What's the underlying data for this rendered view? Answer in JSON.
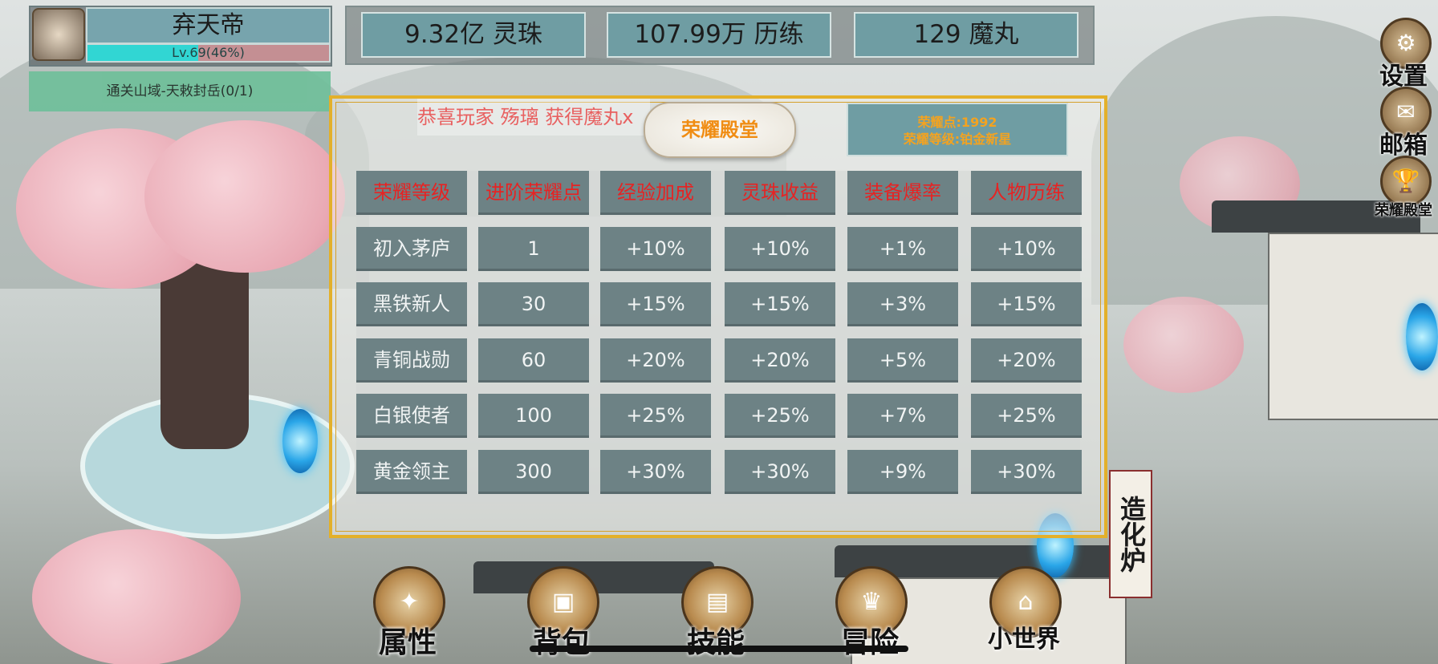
{
  "player": {
    "name": "弃天帝",
    "level_text": "Lv.69(46%)",
    "level_progress": 0.46
  },
  "quest": {
    "text": "通关山域-天敕封岳(0/1)"
  },
  "resources": [
    {
      "label": "9.32亿 灵珠"
    },
    {
      "label": "107.99万 历练"
    },
    {
      "label": "129 魔丸"
    }
  ],
  "side_buttons": {
    "settings": {
      "label": "设置",
      "icon": "gear-icon"
    },
    "mail": {
      "label": "邮箱",
      "icon": "envelope-icon"
    },
    "honor_hall": {
      "label": "荣耀殿堂",
      "icon": "trophy-icon"
    }
  },
  "panel": {
    "ticker": "恭喜玩家 殇璃 获得魔丸x",
    "title": "荣耀殿堂",
    "honor_points": "荣耀点:1992",
    "honor_level": "荣耀等级:铂金新星"
  },
  "table": {
    "headers": [
      "荣耀等级",
      "进阶荣耀点",
      "经验加成",
      "灵珠收益",
      "装备爆率",
      "人物历练"
    ],
    "rows": [
      [
        "初入茅庐",
        "1",
        "+10%",
        "+10%",
        "+1%",
        "+10%"
      ],
      [
        "黑铁新人",
        "30",
        "+15%",
        "+15%",
        "+3%",
        "+15%"
      ],
      [
        "青铜战勋",
        "60",
        "+20%",
        "+20%",
        "+5%",
        "+20%"
      ],
      [
        "白银使者",
        "100",
        "+25%",
        "+25%",
        "+7%",
        "+25%"
      ],
      [
        "黄金领主",
        "300",
        "+30%",
        "+30%",
        "+9%",
        "+30%"
      ]
    ]
  },
  "bottom_nav": [
    {
      "label": "属性",
      "icon": "attributes-icon"
    },
    {
      "label": "背包",
      "icon": "backpack-icon"
    },
    {
      "label": "技能",
      "icon": "skill-book-icon"
    },
    {
      "label": "冒险",
      "icon": "adventure-icon"
    },
    {
      "label": "小世界",
      "icon": "pavilion-icon"
    }
  ],
  "furnace": {
    "label": "造化炉"
  },
  "colors": {
    "gold_border": "#e3b02a",
    "header_red": "#e62323",
    "cell_bg": "#6d8285",
    "title_orange": "#f08d14"
  }
}
